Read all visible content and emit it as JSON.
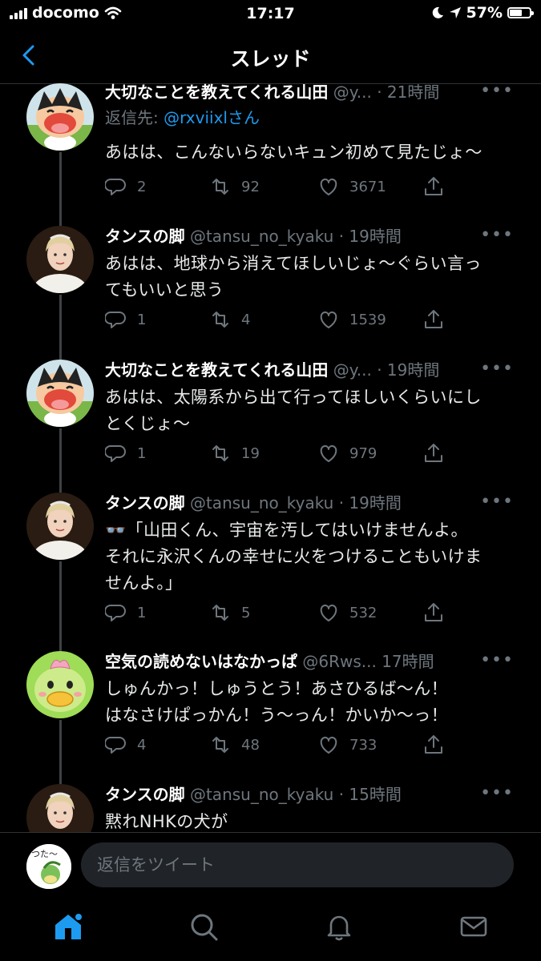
{
  "status_bar": {
    "carrier": "docomo",
    "time": "17:17",
    "battery": "57%"
  },
  "header": {
    "title": "スレッド"
  },
  "tweets": [
    {
      "name": "大切なことを教えてくれる山田",
      "handle": "@y...",
      "time": "· 21時間",
      "reply_prefix": "返信先: ",
      "reply_mention": "@rxviixlさん",
      "text": "あはは、こんないらないキュン初めて見たじょ〜",
      "replies": "2",
      "retweets": "92",
      "likes": "3671"
    },
    {
      "name": "タンスの脚",
      "handle": "@tansu_no_kyaku",
      "time": "· 19時間",
      "text_lines": [
        "あはは、地球から消えてほしいじょ〜ぐらい言っ",
        "てもいいと思う"
      ],
      "replies": "1",
      "retweets": "4",
      "likes": "1539"
    },
    {
      "name": "大切なことを教えてくれる山田",
      "handle": "@y...",
      "time": "· 19時間",
      "text_lines": [
        "あはは、太陽系から出て行ってほしいくらいにし",
        "とくじょ〜"
      ],
      "replies": "1",
      "retweets": "19",
      "likes": "979"
    },
    {
      "name": "タンスの脚",
      "handle": "@tansu_no_kyaku",
      "time": "· 19時間",
      "text_lines": [
        "👓「山田くん、宇宙を汚してはいけませんよ。",
        "それに永沢くんの幸せに火をつけることもいけま",
        "せんよ。」"
      ],
      "replies": "1",
      "retweets": "5",
      "likes": "532"
    },
    {
      "name": "空気の読めないはなかっぱ",
      "handle": "@6Rws...",
      "time": "17時間",
      "text_lines": [
        "しゅんかっ！しゅうとう！あさひるば〜ん！",
        "はなさけぱっかん！う〜っん！かいか〜っ！"
      ],
      "replies": "4",
      "retweets": "48",
      "likes": "733"
    },
    {
      "name": "タンスの脚",
      "handle": "@tansu_no_kyaku",
      "time": "· 15時間",
      "text": "黙れNHKの犬が"
    }
  ],
  "reply_bar": {
    "placeholder": "返信をツイート",
    "avatar_text": "つた〜"
  },
  "tabs": [
    "home",
    "search",
    "notifications",
    "messages"
  ],
  "colors": {
    "accent": "#1d9bf0",
    "muted": "#6e767d",
    "background": "#000000"
  }
}
